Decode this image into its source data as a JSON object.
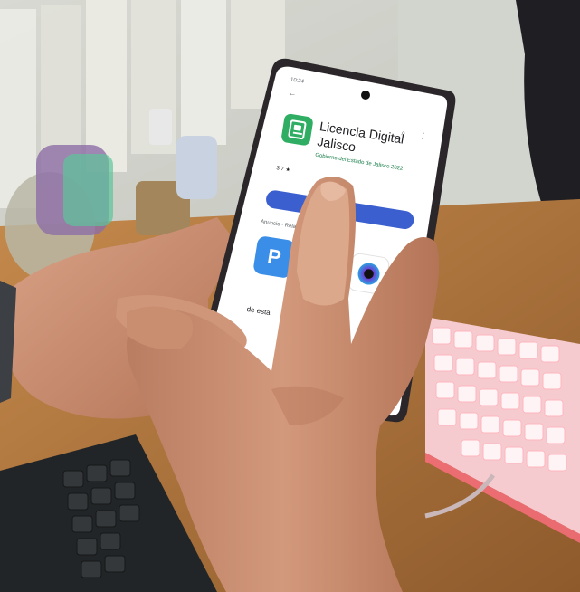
{
  "photo": {
    "subject": "hand-using-smartphone",
    "colors": {
      "wall": "#e3e3de",
      "desk": "#b4773e",
      "keyboard_white": "#f3dfe1",
      "keyboard_glow": "#ff8f9c",
      "keyboard_black": "#222527",
      "skin": "#c98d70",
      "phone_frame": "#2b2629"
    }
  },
  "phone": {
    "status_time": "10:24",
    "app": {
      "icon": "driver-license-icon",
      "title_line1": "Licencia Digital",
      "title_line2": "Jalisco",
      "developer": "Gobierno del Estado de Jalisco 2022",
      "rating": "3.7 ★",
      "install_button_color": "#3b5fcf",
      "section_label": "Anuncio · Relacionados",
      "partial_label": "de esta"
    },
    "related_apps": [
      {
        "icon": "blue-p-icon",
        "color": "#3a8ee8"
      },
      {
        "icon": "red-app-icon",
        "color": "#e8433e"
      },
      {
        "icon": "camera-lens-icon",
        "color": "#6a3fd2"
      }
    ]
  }
}
